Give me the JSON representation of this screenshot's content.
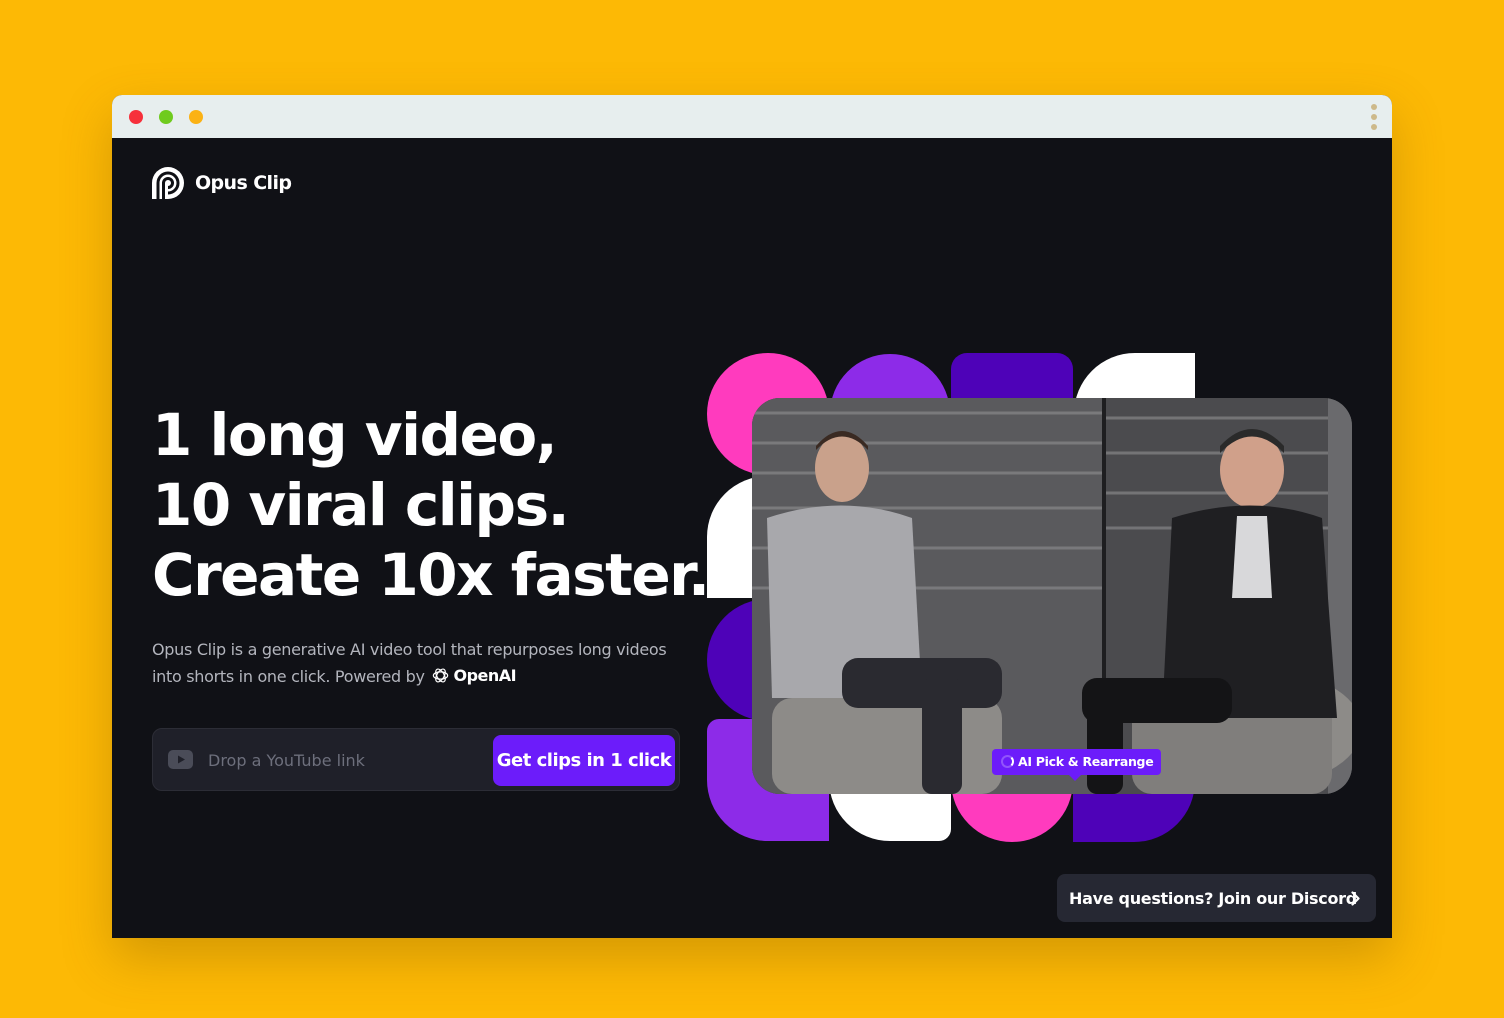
{
  "brand": {
    "name": "Opus Clip"
  },
  "hero": {
    "line1": "1 long video,",
    "line2": "10 viral clips.",
    "line3": "Create 10x faster.",
    "subtitle": "Opus Clip is a generative AI video tool that repurposes long videos into shorts in one click. Powered by",
    "powered_by": "OpenAI"
  },
  "form": {
    "placeholder": "Drop a YouTube link",
    "cta_label": "Get clips in 1 click"
  },
  "video": {
    "badge": "AI Pick & Rearrange"
  },
  "discord": {
    "label": "Have questions? Join our Discord"
  },
  "colors": {
    "background": "#FDB905",
    "page": "#101116",
    "accent": "#6C1CFA",
    "pink": "#FF3BBE",
    "violet": "#8D2BE8",
    "indigo": "#4E02B8"
  },
  "icons": [
    "opus-clip-logo-icon",
    "youtube-icon",
    "openai-icon",
    "spinner-icon",
    "chevron-right-icon"
  ]
}
